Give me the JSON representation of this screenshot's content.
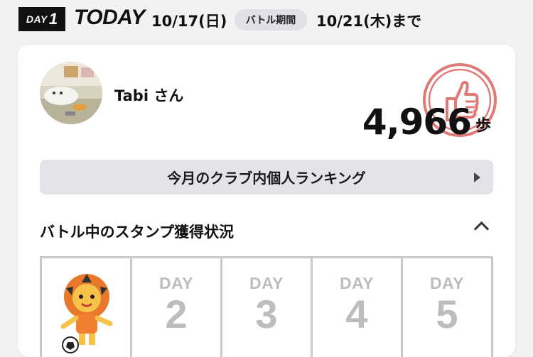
{
  "header": {
    "day_word": "DAY",
    "day_number": "1",
    "today_label": "TODAY",
    "start_date": "10/17(日)",
    "period_label": "バトル期間",
    "end_date": "10/21(木)まで"
  },
  "profile": {
    "name": "Tabi さん",
    "steps": "4,966",
    "steps_unit": "歩"
  },
  "ranking_button": {
    "label": "今月のクラブ内個人ランキング"
  },
  "stamp_section": {
    "title": "バトル中のスタンプ獲得状況",
    "days": [
      {
        "label": "",
        "number": "",
        "stamped": true
      },
      {
        "label": "DAY",
        "number": "2",
        "stamped": false
      },
      {
        "label": "DAY",
        "number": "3",
        "stamped": false
      },
      {
        "label": "DAY",
        "number": "4",
        "stamped": false
      },
      {
        "label": "DAY",
        "number": "5",
        "stamped": false
      }
    ]
  },
  "colors": {
    "stamp_red": "#e07a76",
    "pill_bg": "#e0e0e6",
    "button_bg": "#e3e3ea",
    "grid_border": "#c9c9c9"
  }
}
